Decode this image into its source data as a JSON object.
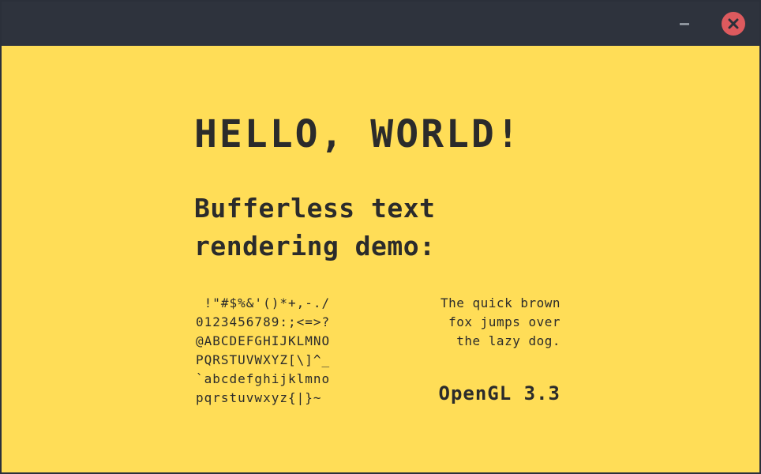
{
  "window": {
    "background_color": "#ffdd57",
    "titlebar_color": "#2e333d",
    "close_button_color": "#dd5a5e"
  },
  "titlebar": {
    "minimize_icon": "minimize-icon",
    "close_icon": "close-icon"
  },
  "content": {
    "headline": "HELLO, WORLD!",
    "subtitle_lines": [
      "Bufferless text",
      "rendering demo:"
    ],
    "charset_lines": [
      " !\"#$%&'()*+,-./",
      "0123456789:;<=>?",
      "@ABCDEFGHIJKLMNO",
      "PQRSTUVWXYZ[\\]^_",
      "`abcdefghijklmno",
      "pqrstuvwxyz{|}~"
    ],
    "pangram_lines": [
      "The quick brown",
      "fox jumps over",
      "the lazy dog."
    ],
    "gl_version": "OpenGL 3.3"
  }
}
